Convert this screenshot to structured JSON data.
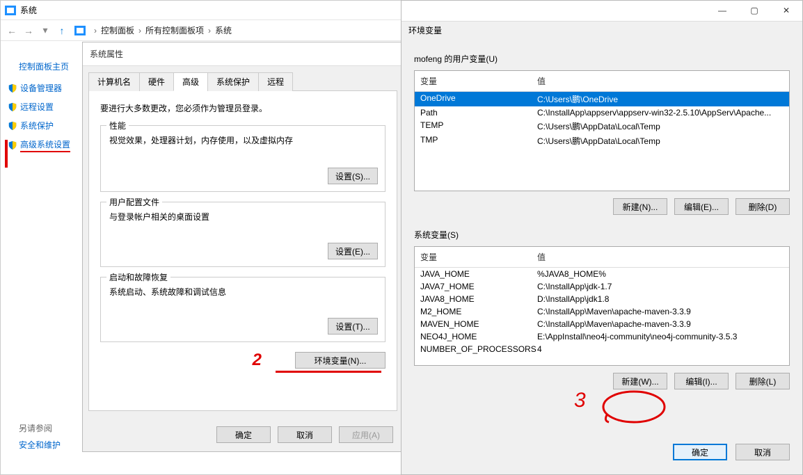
{
  "system_window": {
    "title": "系统",
    "breadcrumb": [
      "控制面板",
      "所有控制面板项",
      "系统"
    ],
    "cp_home": "控制面板主页",
    "sidebar": [
      {
        "label": "设备管理器"
      },
      {
        "label": "远程设置"
      },
      {
        "label": "系统保护"
      },
      {
        "label": "高级系统设置"
      }
    ],
    "see_also": {
      "title": "另请参阅",
      "link": "安全和维护"
    }
  },
  "props_dialog": {
    "title": "系统属性",
    "tabs": [
      "计算机名",
      "硬件",
      "高级",
      "系统保护",
      "远程"
    ],
    "active_tab": 2,
    "requires_admin": "要进行大多数更改，您必须作为管理员登录。",
    "perf": {
      "legend": "性能",
      "desc": "视觉效果，处理器计划，内存使用，以及虚拟内存",
      "btn": "设置(S)..."
    },
    "profile": {
      "legend": "用户配置文件",
      "desc": "与登录帐户相关的桌面设置",
      "btn": "设置(E)..."
    },
    "startup": {
      "legend": "启动和故障恢复",
      "desc": "系统启动、系统故障和调试信息",
      "btn": "设置(T)..."
    },
    "env_btn": "环境变量(N)...",
    "ok": "确定",
    "cancel": "取消",
    "apply": "应用(A)"
  },
  "env_dialog": {
    "title": "环境变量",
    "user_section_label": "mofeng 的用户变量(U)",
    "col_var": "变量",
    "col_val": "值",
    "user_vars": [
      {
        "name": "OneDrive",
        "value": "C:\\Users\\鹏\\OneDrive"
      },
      {
        "name": "Path",
        "value": "C:\\InstallApp\\appserv\\appserv-win32-2.5.10\\AppServ\\Apache..."
      },
      {
        "name": "TEMP",
        "value": "C:\\Users\\鹏\\AppData\\Local\\Temp"
      },
      {
        "name": "TMP",
        "value": "C:\\Users\\鹏\\AppData\\Local\\Temp"
      }
    ],
    "user_selected_index": 0,
    "user_buttons": {
      "new": "新建(N)...",
      "edit": "编辑(E)...",
      "delete": "删除(D)"
    },
    "sys_section_label": "系统变量(S)",
    "sys_vars": [
      {
        "name": "JAVA_HOME",
        "value": "%JAVA8_HOME%"
      },
      {
        "name": "JAVA7_HOME",
        "value": "C:\\InstallApp\\jdk-1.7"
      },
      {
        "name": "JAVA8_HOME",
        "value": "D:\\InstallApp\\jdk1.8"
      },
      {
        "name": "M2_HOME",
        "value": "C:\\InstallApp\\Maven\\apache-maven-3.3.9"
      },
      {
        "name": "MAVEN_HOME",
        "value": "C:\\InstallApp\\Maven\\apache-maven-3.3.9"
      },
      {
        "name": "NEO4J_HOME",
        "value": "E:\\AppInstall\\neo4j-community\\neo4j-community-3.5.3"
      },
      {
        "name": "NUMBER_OF_PROCESSORS",
        "value": "4"
      }
    ],
    "sys_buttons": {
      "new": "新建(W)...",
      "edit": "编辑(I)...",
      "delete": "删除(L)"
    },
    "ok": "确定",
    "cancel": "取消"
  },
  "annotations": {
    "m1": "1",
    "m2": "2",
    "m3": "3"
  }
}
